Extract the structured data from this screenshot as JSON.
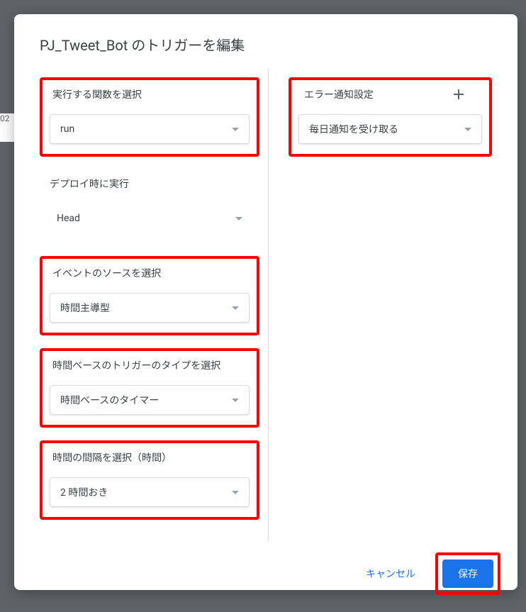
{
  "title": "PJ_Tweet_Bot のトリガーを編集",
  "left": {
    "function_label": "実行する関数を選択",
    "function_value": "run",
    "deploy_label": "デプロイ時に実行",
    "deploy_value": "Head",
    "event_source_label": "イベントのソースを選択",
    "event_source_value": "時間主導型",
    "trigger_type_label": "時間ベースのトリガーのタイプを選択",
    "trigger_type_value": "時間ベースのタイマー",
    "interval_label": "時間の間隔を選択（時間）",
    "interval_value": "2 時間おき"
  },
  "right": {
    "error_label": "エラー通知設定",
    "error_value": "毎日通知を受け取る"
  },
  "footer": {
    "cancel": "キャンセル",
    "save": "保存"
  },
  "bg_text": "02"
}
